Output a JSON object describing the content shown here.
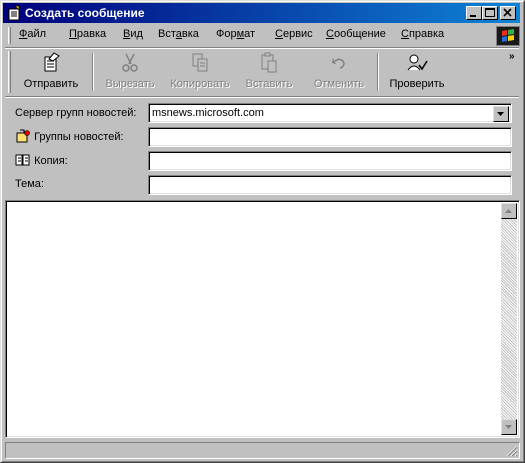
{
  "window": {
    "title": "Создать сообщение"
  },
  "menu": {
    "items": [
      {
        "pre": "",
        "key": "Ф",
        "post": "айл"
      },
      {
        "pre": "",
        "key": "П",
        "post": "равка"
      },
      {
        "pre": "",
        "key": "В",
        "post": "ид"
      },
      {
        "pre": "Вст",
        "key": "а",
        "post": "вка"
      },
      {
        "pre": "Фор",
        "key": "м",
        "post": "ат"
      },
      {
        "pre": "",
        "key": "С",
        "post": "ервис"
      },
      {
        "pre": "",
        "key": "С",
        "post": "ообщение"
      },
      {
        "pre": "",
        "key": "С",
        "post": "правка"
      }
    ]
  },
  "toolbar": {
    "send": "Отправить",
    "cut": "Вырезать",
    "copy": "Копировать",
    "paste": "Вставить",
    "undo": "Отменить",
    "check": "Проверить",
    "more": "»"
  },
  "header": {
    "server_label": "Сервер групп новостей:",
    "server_value": "msnews.microsoft.com",
    "newsgroups_label": "Группы новостей:",
    "newsgroups_value": "",
    "cc_label": "Копия:",
    "cc_value": "",
    "subject_label": "Тема:",
    "subject_value": ""
  },
  "body": {
    "text": ""
  },
  "status": {
    "text": ""
  }
}
